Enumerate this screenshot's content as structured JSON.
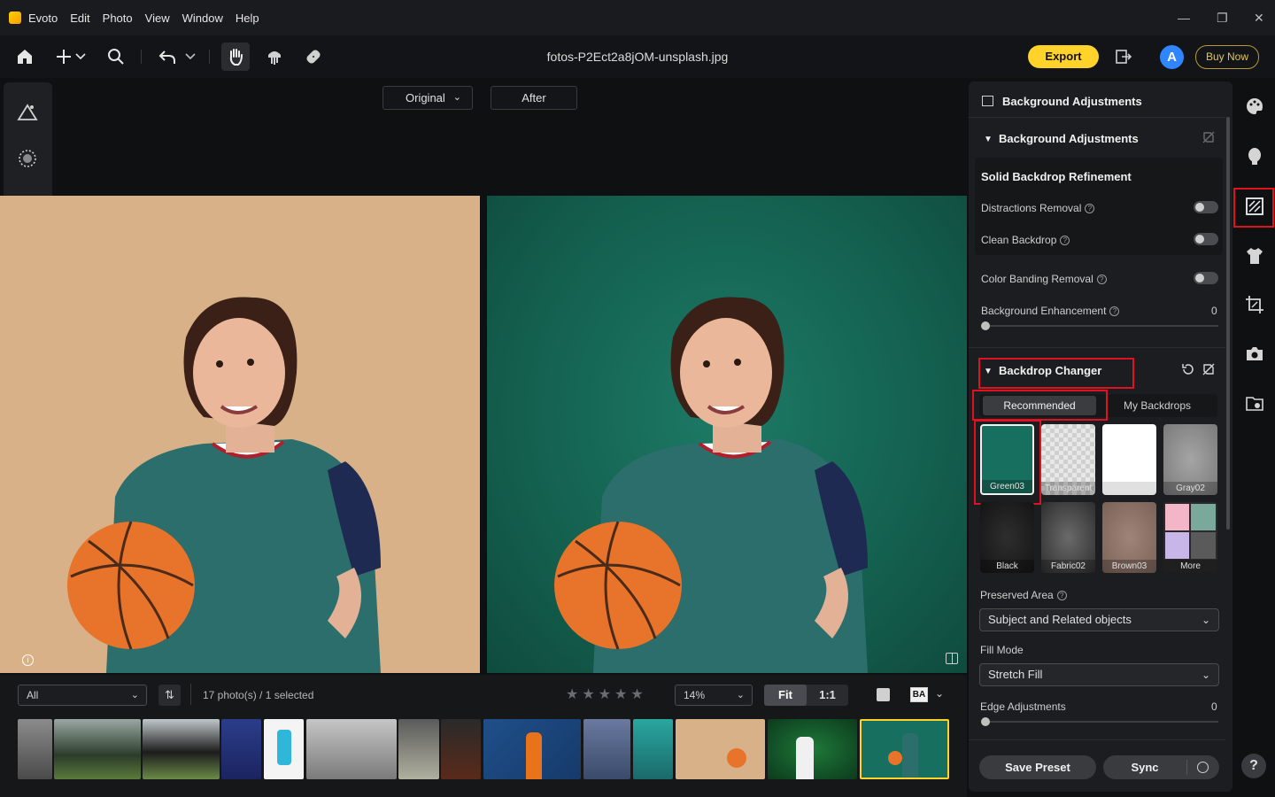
{
  "app": {
    "name": "Evoto",
    "menu": [
      "Edit",
      "Photo",
      "View",
      "Window",
      "Help"
    ],
    "file_name": "fotos-P2Ect2a8jOM-unsplash.jpg"
  },
  "toolbar": {
    "export_label": "Export",
    "avatar_letter": "A",
    "buy_label": "Buy Now"
  },
  "compare": {
    "original_label": "Original",
    "after_label": "After"
  },
  "filmstrip": {
    "filter_value": "All",
    "count_text": "17 photo(s) / 1 selected",
    "zoom_value": "14%",
    "fit_label": "Fit",
    "one_to_one_label": "1:1",
    "before_after_label": "BA"
  },
  "panel": {
    "header_title": "Background Adjustments",
    "section_title": "Background Adjustments",
    "solid_title": "Solid Backdrop Refinement",
    "distractions_label": "Distractions Removal",
    "clean_label": "Clean Backdrop",
    "banding_label": "Color Banding Removal",
    "enhancement_label": "Background Enhancement",
    "enhancement_value": "0",
    "backdrop_title": "Backdrop Changer",
    "tab_recommended": "Recommended",
    "tab_my": "My Backdrops",
    "swatches": [
      {
        "label": "Green03",
        "color": "#17705f"
      },
      {
        "label": "Transparent",
        "color": "checker"
      },
      {
        "label": "White",
        "color": "#ffffff"
      },
      {
        "label": "Gray02",
        "color": "#8d8d8d"
      },
      {
        "label": "Black",
        "color": "#1f1f1f"
      },
      {
        "label": "Fabric02",
        "color": "#5e5e5e"
      },
      {
        "label": "Brown03",
        "color": "#8f7468"
      },
      {
        "label": "More",
        "color": "multi"
      }
    ],
    "preserved_label": "Preserved Area",
    "preserved_value": "Subject and Related objects",
    "fill_label": "Fill Mode",
    "fill_value": "Stretch Fill",
    "edge_label": "Edge Adjustments",
    "edge_value": "0",
    "save_preset": "Save Preset",
    "sync": "Sync"
  },
  "colors": {
    "accent": "#ffd32a",
    "highlight": "#e0121f",
    "backdrop_original": "#d9b188",
    "backdrop_after": "#17705f"
  }
}
